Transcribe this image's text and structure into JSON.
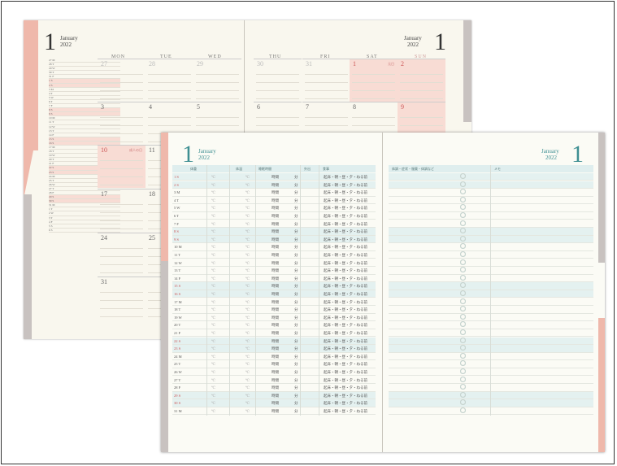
{
  "monthly": {
    "month_number": "1",
    "month_name": "January",
    "year": "2022",
    "weekdays": [
      "MON",
      "TUE",
      "WED",
      "THU",
      "FRI",
      "SAT",
      "SUN"
    ],
    "week_rows": [
      [
        "27",
        "28",
        "29",
        "30",
        "31",
        "1",
        "2"
      ],
      [
        "3",
        "4",
        "5",
        "6",
        "7",
        "8",
        "9"
      ],
      [
        "10",
        "11",
        "",
        "",
        "",
        "",
        ""
      ],
      [
        "17",
        "18",
        "",
        "",
        "",
        "",
        ""
      ],
      [
        "24",
        "25",
        "",
        "",
        "",
        "",
        ""
      ],
      [
        "31",
        "",
        "",
        "",
        "",
        "",
        ""
      ]
    ],
    "holiday_note": "成人の日",
    "new_year_note": "元日",
    "mini_days": [
      "27 M",
      "28 T",
      "29 W",
      "30 T",
      "31 F",
      "1 S",
      "2 S",
      "3 M",
      "4 T",
      "5 W",
      "6 T",
      "7 F",
      "8 S",
      "9 S",
      "10 M",
      "11 T",
      "12 W",
      "13 T",
      "14 F",
      "15 S",
      "16 S",
      "17 M",
      "18 T",
      "19 W",
      "20 T",
      "21 F",
      "22 S",
      "23 S",
      "24 M",
      "25 T",
      "26 W",
      "27 T",
      "28 F",
      "29 S",
      "30 S",
      "31 M",
      "1 T",
      "2 W",
      "3 T",
      "4 F",
      "5 S",
      "6 S"
    ]
  },
  "daily": {
    "month_number": "1",
    "month_name": "January",
    "year": "2022",
    "headers": {
      "work": "体重",
      "temp": "体温",
      "sleep": "睡眠時間",
      "outing": "外出",
      "meal": "食事",
      "condition": "体調・症状・服薬・体調など",
      "memo": "メモ"
    },
    "sleep_text": "時間",
    "sleep_unit": "分",
    "meal_text": "起床・朝・昼・夕・ねる前",
    "temp_unit": "℃",
    "days": [
      "1 S",
      "2 S",
      "3 M",
      "4 T",
      "5 W",
      "6 T",
      "7 F",
      "8 S",
      "9 S",
      "10 M",
      "11 T",
      "12 W",
      "13 T",
      "14 F",
      "15 S",
      "16 S",
      "17 M",
      "18 T",
      "19 W",
      "20 T",
      "21 F",
      "22 S",
      "23 S",
      "24 M",
      "25 T",
      "26 W",
      "27 T",
      "28 F",
      "29 S",
      "30 S",
      "31 M"
    ]
  }
}
